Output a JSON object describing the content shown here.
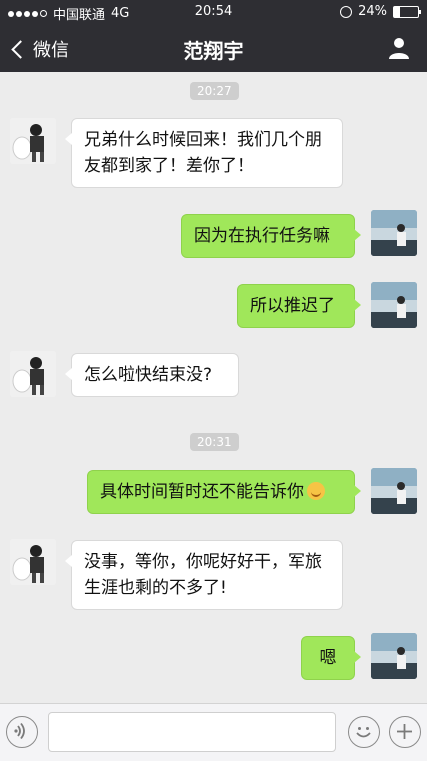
{
  "status_bar": {
    "carrier": "中国联通",
    "network": "4G",
    "time": "20:54",
    "battery_text": "24%",
    "battery_level": 0.24,
    "signal_bars_filled": 4,
    "signal_bars_total": 5
  },
  "nav": {
    "back_label": "微信",
    "title": "范翔宇",
    "profile_icon": "person-icon"
  },
  "chat": {
    "timestamps": [
      "20:27",
      "20:31"
    ],
    "messages": [
      {
        "side": "in",
        "text": "兄弟什么时候回来！我们几个朋友都到家了！差你了！"
      },
      {
        "side": "out",
        "text": "因为在执行任务嘛"
      },
      {
        "side": "out",
        "text": "所以推迟了"
      },
      {
        "side": "in",
        "text": "怎么啦快结束没?"
      },
      {
        "side": "out",
        "text": "具体时间暂时还不能告诉你",
        "emoji": "grin-emoji"
      },
      {
        "side": "in",
        "text": "没事，等你，你呢好好干，军旅生涯也剩的不多了!"
      },
      {
        "side": "out",
        "text": "嗯"
      }
    ]
  },
  "input_bar": {
    "voice_icon": "voice-icon",
    "emoji_icon": "emoji-icon",
    "add_icon": "plus-icon"
  },
  "colors": {
    "bar": "#2e2e33",
    "chat_bg": "#ececec",
    "outgoing": "#a0e75a",
    "incoming": "#ffffff",
    "timestamp_bg": "#cecece"
  }
}
